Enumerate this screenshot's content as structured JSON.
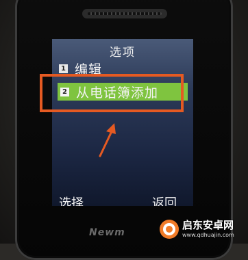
{
  "screen": {
    "title": "选项",
    "items": [
      {
        "number": "1",
        "label": "编辑"
      },
      {
        "number": "2",
        "label": "从电话簿添加"
      }
    ],
    "selected_index": 1,
    "softkeys": {
      "left": "选择",
      "right": "返回"
    }
  },
  "device": {
    "brand": "Newm"
  },
  "watermark": {
    "name": "启东安卓网",
    "url": "www.qdhuajin.com"
  },
  "colors": {
    "highlight": "#7fc43f",
    "annotation": "#e55a22",
    "screen_bg": "#1b2642"
  }
}
